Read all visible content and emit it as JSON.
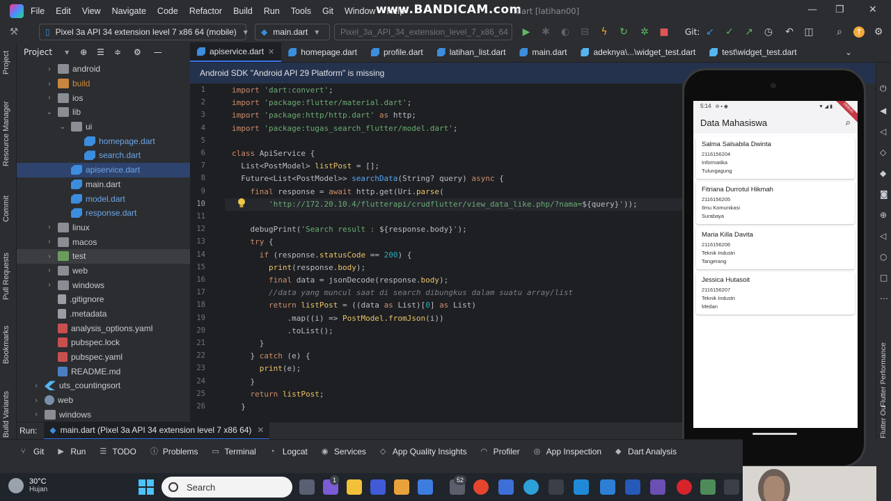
{
  "menubar": {
    "items": [
      "File",
      "Edit",
      "View",
      "Navigate",
      "Code",
      "Refactor",
      "Build",
      "Run",
      "Tools",
      "Git",
      "Window",
      "Help"
    ],
    "watermark": "www.BANDICAM.com",
    "project_title": ".dart [latihan00]"
  },
  "toolbar": {
    "device": "Pixel 3a API 34 extension level 7 x86 64 (mobile)",
    "run_config": "main.dart",
    "emulator": "Pixel_3a_API_34_extension_level_7_x86_64",
    "git_label": "Git:"
  },
  "left_strip": {
    "labels": [
      "Project",
      "Resource Manager",
      "Commit",
      "Pull Requests",
      "Bookmarks",
      "Build Variants"
    ]
  },
  "project": {
    "title": "Project",
    "tree": [
      {
        "label": "android",
        "indent": 1,
        "arrow": "›",
        "icon": "folder",
        "color": ""
      },
      {
        "label": "build",
        "indent": 1,
        "arrow": "›",
        "icon": "folder-orange",
        "color": "orange"
      },
      {
        "label": "ios",
        "indent": 1,
        "arrow": "›",
        "icon": "folder",
        "color": ""
      },
      {
        "label": "lib",
        "indent": 1,
        "arrow": "⌄",
        "icon": "folder",
        "color": ""
      },
      {
        "label": "ui",
        "indent": 2,
        "arrow": "⌄",
        "icon": "folder",
        "color": ""
      },
      {
        "label": "homepage.dart",
        "indent": 3,
        "arrow": "",
        "icon": "dart",
        "color": "blue"
      },
      {
        "label": "search.dart",
        "indent": 3,
        "arrow": "",
        "icon": "dart",
        "color": "blue"
      },
      {
        "label": "apiservice.dart",
        "indent": 2,
        "arrow": "",
        "icon": "dart",
        "color": "blue",
        "selected": true
      },
      {
        "label": "main.dart",
        "indent": 2,
        "arrow": "",
        "icon": "dart",
        "color": ""
      },
      {
        "label": "model.dart",
        "indent": 2,
        "arrow": "",
        "icon": "dart",
        "color": "blue"
      },
      {
        "label": "response.dart",
        "indent": 2,
        "arrow": "",
        "icon": "dart",
        "color": "blue"
      },
      {
        "label": "linux",
        "indent": 1,
        "arrow": "›",
        "icon": "folder",
        "color": ""
      },
      {
        "label": "macos",
        "indent": 1,
        "arrow": "›",
        "icon": "folder",
        "color": ""
      },
      {
        "label": "test",
        "indent": 1,
        "arrow": "›",
        "icon": "folder-green",
        "color": "",
        "highlight": true
      },
      {
        "label": "web",
        "indent": 1,
        "arrow": "›",
        "icon": "folder",
        "color": ""
      },
      {
        "label": "windows",
        "indent": 1,
        "arrow": "›",
        "icon": "folder",
        "color": ""
      },
      {
        "label": ".gitignore",
        "indent": 1,
        "arrow": "",
        "icon": "file",
        "color": ""
      },
      {
        "label": ".metadata",
        "indent": 1,
        "arrow": "",
        "icon": "file",
        "color": ""
      },
      {
        "label": "analysis_options.yaml",
        "indent": 1,
        "arrow": "",
        "icon": "yaml",
        "color": ""
      },
      {
        "label": "pubspec.lock",
        "indent": 1,
        "arrow": "",
        "icon": "yaml",
        "color": ""
      },
      {
        "label": "pubspec.yaml",
        "indent": 1,
        "arrow": "",
        "icon": "yaml",
        "color": ""
      },
      {
        "label": "README.md",
        "indent": 1,
        "arrow": "",
        "icon": "md",
        "color": ""
      },
      {
        "label": "uts_countingsort",
        "indent": 0,
        "arrow": "›",
        "icon": "flutter",
        "color": ""
      },
      {
        "label": "web",
        "indent": 0,
        "arrow": "›",
        "icon": "web",
        "color": ""
      },
      {
        "label": "windows",
        "indent": 0,
        "arrow": "›",
        "icon": "folder",
        "color": ""
      }
    ]
  },
  "tabs": [
    {
      "label": "apiservice.dart",
      "active": true,
      "test": false
    },
    {
      "label": "homepage.dart",
      "active": false,
      "test": false
    },
    {
      "label": "profile.dart",
      "active": false,
      "test": false
    },
    {
      "label": "latihan_list.dart",
      "active": false,
      "test": false
    },
    {
      "label": "main.dart",
      "active": false,
      "test": false
    },
    {
      "label": "adeknya\\...\\widget_test.dart",
      "active": false,
      "test": true
    },
    {
      "label": "test\\widget_test.dart",
      "active": false,
      "test": true
    }
  ],
  "banner": {
    "text": "Android SDK \"Android API 29 Platform\" is missing"
  },
  "editor": {
    "current_line": 10,
    "line_numbers": [
      "1",
      "2",
      "3",
      "4",
      "5",
      "6",
      "7",
      "8",
      "9",
      "10",
      "11",
      "12",
      "13",
      "14",
      "15",
      "16",
      "17",
      "18",
      "19",
      "20",
      "21",
      "22",
      "23",
      "24",
      "25",
      "26"
    ],
    "lines": [
      [
        {
          "t": "import ",
          "c": "kw"
        },
        {
          "t": "'dart:convert'",
          "c": "str"
        },
        {
          "t": ";",
          "c": ""
        }
      ],
      [
        {
          "t": "import ",
          "c": "kw"
        },
        {
          "t": "'package:flutter/material.dart'",
          "c": "str"
        },
        {
          "t": ";",
          "c": ""
        }
      ],
      [
        {
          "t": "import ",
          "c": "kw"
        },
        {
          "t": "'package:http/http.dart'",
          "c": "str"
        },
        {
          "t": " as ",
          "c": "kw"
        },
        {
          "t": "http;",
          "c": ""
        }
      ],
      [
        {
          "t": "import ",
          "c": "kw"
        },
        {
          "t": "'package:tugas_search_flutter/model.dart'",
          "c": "str"
        },
        {
          "t": ";",
          "c": ""
        }
      ],
      [],
      [
        {
          "t": "class ",
          "c": "kw"
        },
        {
          "t": "ApiService {",
          "c": ""
        }
      ],
      [
        {
          "t": "  List<PostModel> ",
          "c": ""
        },
        {
          "t": "listPost",
          "c": "fnc"
        },
        {
          "t": " = [];",
          "c": ""
        }
      ],
      [
        {
          "t": "  Future<List<PostModel>> ",
          "c": ""
        },
        {
          "t": "searchData",
          "c": "fn"
        },
        {
          "t": "(String? query) ",
          "c": ""
        },
        {
          "t": "async",
          "c": "kw"
        },
        {
          "t": " {",
          "c": ""
        }
      ],
      [
        {
          "t": "    final ",
          "c": "kw"
        },
        {
          "t": "response = ",
          "c": ""
        },
        {
          "t": "await ",
          "c": "kw"
        },
        {
          "t": "http.get(Uri.",
          "c": ""
        },
        {
          "t": "parse",
          "c": "fnc"
        },
        {
          "t": "(",
          "c": ""
        }
      ],
      [
        {
          "t": "        'http://172.20.10.4/flutterapi/crudflutter/view_data_like.php/?nama=",
          "c": "str"
        },
        {
          "t": "${query}",
          "c": ""
        },
        {
          "t": "'",
          "c": "str"
        },
        {
          "t": "));",
          "c": ""
        }
      ],
      [],
      [
        {
          "t": "    debugPrint(",
          "c": ""
        },
        {
          "t": "'Search result : ",
          "c": "str"
        },
        {
          "t": "${response.body}",
          "c": ""
        },
        {
          "t": "'",
          "c": "str"
        },
        {
          "t": ");",
          "c": ""
        }
      ],
      [
        {
          "t": "    try ",
          "c": "kw"
        },
        {
          "t": "{",
          "c": ""
        }
      ],
      [
        {
          "t": "      if ",
          "c": "kw"
        },
        {
          "t": "(response.",
          "c": ""
        },
        {
          "t": "statusCode",
          "c": "fnc"
        },
        {
          "t": " == ",
          "c": ""
        },
        {
          "t": "200",
          "c": "num"
        },
        {
          "t": ") {",
          "c": ""
        }
      ],
      [
        {
          "t": "        print",
          "c": "fnc"
        },
        {
          "t": "(response.",
          "c": ""
        },
        {
          "t": "body",
          "c": "fnc"
        },
        {
          "t": ");",
          "c": ""
        }
      ],
      [
        {
          "t": "        final ",
          "c": "kw"
        },
        {
          "t": "data = jsonDecode(response.",
          "c": ""
        },
        {
          "t": "body",
          "c": "fnc"
        },
        {
          "t": ");",
          "c": ""
        }
      ],
      [
        {
          "t": "        //data yang muncul saat di search dibungkus dalam suatu array/list",
          "c": "cm"
        }
      ],
      [
        {
          "t": "        return ",
          "c": "kw"
        },
        {
          "t": "listPost",
          "c": "fnc"
        },
        {
          "t": " = ((data ",
          "c": ""
        },
        {
          "t": "as ",
          "c": "kw"
        },
        {
          "t": "List)[",
          "c": ""
        },
        {
          "t": "0",
          "c": "num"
        },
        {
          "t": "] ",
          "c": ""
        },
        {
          "t": "as ",
          "c": "kw"
        },
        {
          "t": "List)",
          "c": ""
        }
      ],
      [
        {
          "t": "            .map((i) => ",
          "c": ""
        },
        {
          "t": "PostModel.fromJson",
          "c": "fnc"
        },
        {
          "t": "(i))",
          "c": ""
        }
      ],
      [
        {
          "t": "            .toList();",
          "c": ""
        }
      ],
      [
        {
          "t": "      }",
          "c": ""
        }
      ],
      [
        {
          "t": "    } ",
          "c": ""
        },
        {
          "t": "catch ",
          "c": "kw"
        },
        {
          "t": "(e) {",
          "c": ""
        }
      ],
      [
        {
          "t": "      print",
          "c": "fnc"
        },
        {
          "t": "(e);",
          "c": ""
        }
      ],
      [
        {
          "t": "    }",
          "c": ""
        }
      ],
      [
        {
          "t": "    return ",
          "c": "kw"
        },
        {
          "t": "listPost",
          "c": "fnc"
        },
        {
          "t": ";",
          "c": ""
        }
      ],
      [
        {
          "t": "  }",
          "c": ""
        }
      ]
    ]
  },
  "emulator_app": {
    "status_time": "5:14",
    "debug_label": "DEBUG",
    "title": "Data Mahasiswa",
    "students": [
      {
        "name": "Salma Salsabila Dwinta",
        "nim": "2116156204",
        "prodi": "Informatika",
        "city": "Tulungagung"
      },
      {
        "name": "Fitriana Durrotul Hikmah",
        "nim": "2116156205",
        "prodi": "Ilmu Komunikasi",
        "city": "Surabaya"
      },
      {
        "name": "Maria Killa Davita",
        "nim": "2116156206",
        "prodi": "Teknik Industri",
        "city": "Tangerang"
      },
      {
        "name": "Jessica Hutasoit",
        "nim": "2116156207",
        "prodi": "Teknik Industri",
        "city": "Medan"
      }
    ]
  },
  "right_strip": {
    "labels": [
      "Flutter Performance",
      "Flutter Ou"
    ]
  },
  "runbar": {
    "label": "Run:",
    "tab": "main.dart (Pixel 3a API 34 extension level 7 x86 64)"
  },
  "bottombar": {
    "items": [
      {
        "label": "Git",
        "icon": "⑂"
      },
      {
        "label": "Run",
        "icon": "▶"
      },
      {
        "label": "TODO",
        "icon": "☰"
      },
      {
        "label": "Problems",
        "icon": "ⓘ"
      },
      {
        "label": "Terminal",
        "icon": "▭"
      },
      {
        "label": "Logcat",
        "icon": "◔"
      },
      {
        "label": "Services",
        "icon": "◉"
      },
      {
        "label": "App Quality Insights",
        "icon": "◇"
      },
      {
        "label": "Profiler",
        "icon": "◠"
      },
      {
        "label": "App Inspection",
        "icon": "◎"
      },
      {
        "label": "Dart Analysis",
        "icon": "◆"
      }
    ]
  },
  "taskbar": {
    "temperature": "30°C",
    "weather": "Hujan",
    "search_placeholder": "Search",
    "badge_chat": "1",
    "badge_apps": "52"
  }
}
